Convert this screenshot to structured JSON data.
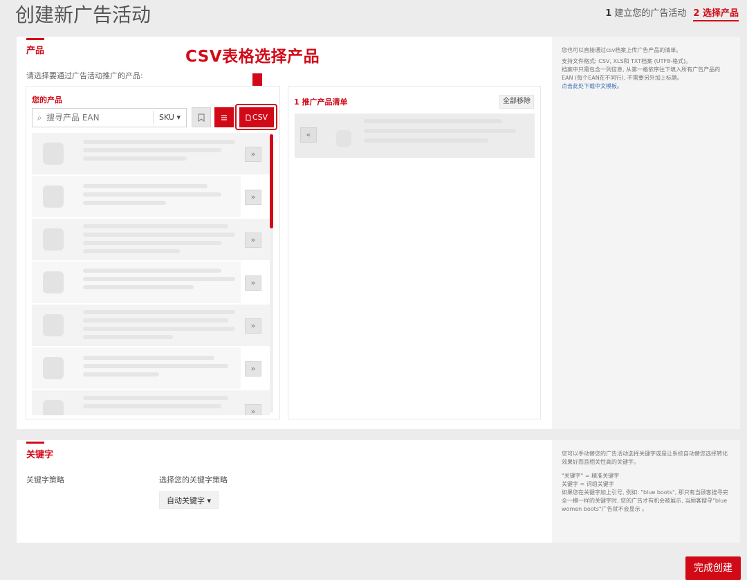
{
  "header": {
    "title": "创建新广告活动",
    "step1_num": "1",
    "step1_label": "建立您的广告活动",
    "step2_num": "2",
    "step2_label": "选择产品"
  },
  "products_section": {
    "title": "产品",
    "hint": "请选择要通过广告活动推广的产品:",
    "annotation": "CSV表格选择产品"
  },
  "your_products": {
    "title": "您的产品",
    "search_placeholder": "搜寻产品 EAN",
    "sku_dropdown": "SKU",
    "csv_button": "CSV",
    "add_button_glyph": "»"
  },
  "promoted": {
    "title": "推广产品清单",
    "count": "1",
    "remove_all": "全部移除",
    "remove_button_glyph": "«"
  },
  "products_help": {
    "line1": "您也可以直接通过csv档案上传广告产品的清单。",
    "line2": "支持文件格式: CSV, XLS和 TXT档案 (UTF8-格式)。",
    "line3": "档案中只需包含一列信息, 从第一格依序往下填入所有广告产品的EAN (每个EAN在不同行), 不需要另外加上标题。",
    "link": "点击此处下载中文模板。"
  },
  "keywords_section": {
    "title": "关键字",
    "strategy_label": "关键字策略",
    "choose_label": "选择您的关键字策略",
    "dropdown_value": "自动关键字"
  },
  "keywords_help": {
    "line1": "您可以手动替您的广告活动选择关键字或是让系统自动替您选择转化效果好而且相关性高的关键字。",
    "line2": "\"关键字\" = 精准关键字",
    "line3": "关键字 = 词组关键字",
    "line4": "如果您在关键字加上引号, 例如: \"blue boots\", 那只有当顾客搜寻完全一模一样的关键字时, 您的广告才有机会被展示, 当顾客搜寻\"blue women boots\"广告就不会显示 。"
  },
  "footer": {
    "finish_button": "完成创建"
  },
  "colors": {
    "accent": "#d20a18",
    "background": "#ececec"
  },
  "icons": {
    "search": "search-icon",
    "bookmark": "bookmark-icon",
    "list": "list-icon",
    "file": "file-icon",
    "arrow": "arrow-down-icon"
  }
}
